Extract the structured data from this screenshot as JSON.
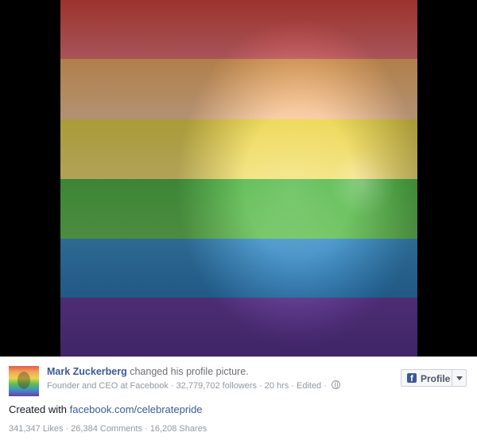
{
  "post": {
    "author": "Mark Zuckerberg",
    "action": "changed his profile picture.",
    "meta": {
      "title": "Founder and CEO at Facebook",
      "followers": "32,779,702 followers",
      "time": "20 hrs",
      "edited": "Edited",
      "privacy_icon": "globe-icon"
    },
    "profile_button": {
      "label": "Profile",
      "icon": "facebook-f-icon",
      "caret_icon": "caret-down-icon"
    },
    "text_prefix": "Created with",
    "link": "facebook.com/celebratepride",
    "stats": {
      "likes": "341,347 Likes",
      "comments": "26,384 Comments",
      "shares": "16,208 Shares"
    },
    "colors": {
      "link": "#3b5998",
      "meta": "#9197a3"
    }
  }
}
